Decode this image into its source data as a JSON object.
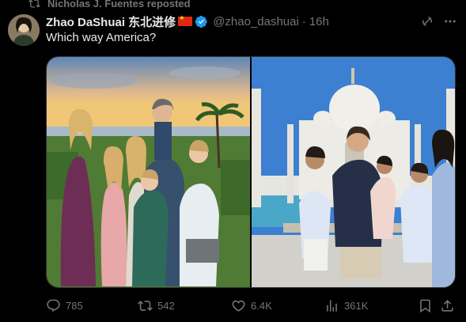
{
  "repost": {
    "text": "Nicholas J. Fuentes reposted",
    "icon": "repost-icon"
  },
  "tweet": {
    "display_name": "Zhao DaShuai 东北进修",
    "flag": "china-flag",
    "verified_icon": "verified-badge-icon",
    "handle": "@zhao_dashuai",
    "separator": "·",
    "timestamp": "16h",
    "text": "Which way America?"
  },
  "media": [
    {
      "description_icon": "family-beach-photo"
    },
    {
      "description_icon": "family-taj-mahal-photo"
    }
  ],
  "actions": {
    "replies": "785",
    "reposts": "542",
    "likes": "6.4K",
    "views": "361K"
  },
  "colors": {
    "accent": "#1d9bf0",
    "muted": "#71767b",
    "text": "#e7e9ea",
    "background": "#000000"
  }
}
